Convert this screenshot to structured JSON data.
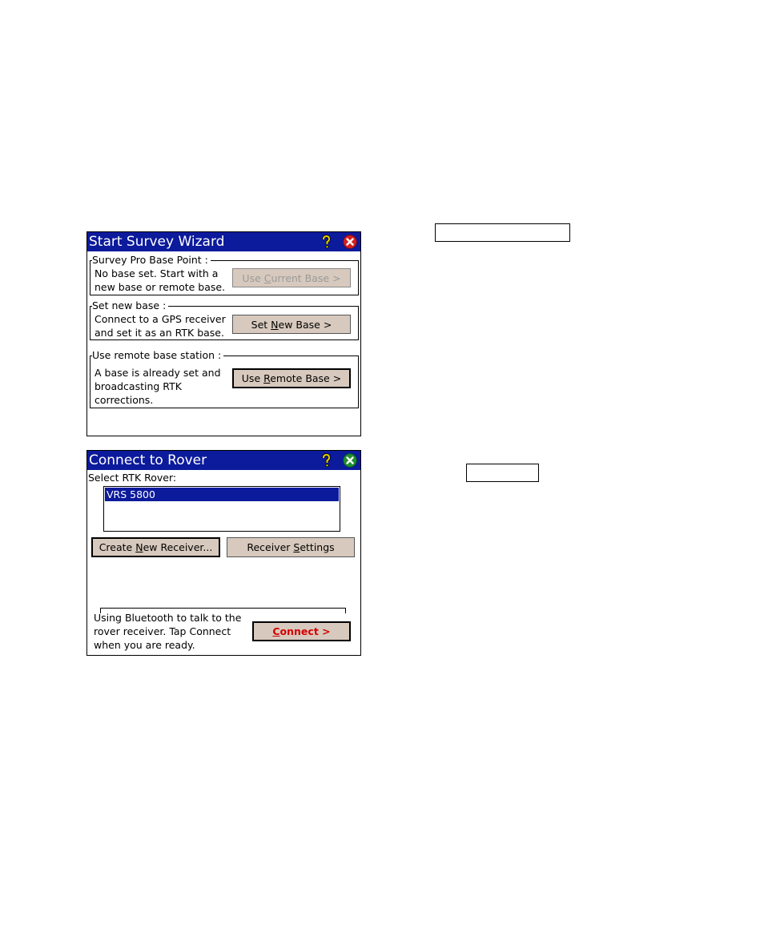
{
  "start_survey_wizard": {
    "title": "Start Survey Wizard",
    "groups": [
      {
        "label": "Survey Pro Base Point :",
        "text": "No base set. Start with a\nnew base or remote base.",
        "button": {
          "pre": "Use ",
          "key": "C",
          "post": "urrent Base >",
          "state": "disabled"
        }
      },
      {
        "label": "Set new base :",
        "text": "Connect to a GPS receiver\nand set it as an RTK base.",
        "button": {
          "pre": "Set ",
          "key": "N",
          "post": "ew Base >",
          "state": "normal"
        }
      },
      {
        "label": "Use remote base station :",
        "text": "A base is already set and\nbroadcasting RTK\ncorrections.",
        "button": {
          "pre": "Use ",
          "key": "R",
          "post": "emote Base >",
          "state": "default"
        }
      }
    ]
  },
  "connect_to_rover": {
    "title": "Connect to Rover",
    "select_label": "Select RTK Rover:",
    "rovers": [
      "VRS 5800"
    ],
    "create_button": {
      "pre": "Create ",
      "key": "N",
      "post": "ew Receiver..."
    },
    "settings_button": {
      "pre": "Receiver ",
      "key": "S",
      "post": "ettings"
    },
    "status_text": "Using Bluetooth to talk to the\nrover receiver. Tap Connect\nwhen you are ready.",
    "connect_button": {
      "pre": "",
      "key": "C",
      "post": "onnect >"
    }
  },
  "icons": {
    "help": "help-icon",
    "close": "close-icon",
    "ok": "ok-icon"
  },
  "colors": {
    "titlebar": "#0c1a9c",
    "button_face": "#d7c9bd",
    "close_red": "#d42020",
    "ok_green": "#1f8f2f",
    "help_yellow": "#e8d000",
    "connect_text": "#d40000"
  }
}
